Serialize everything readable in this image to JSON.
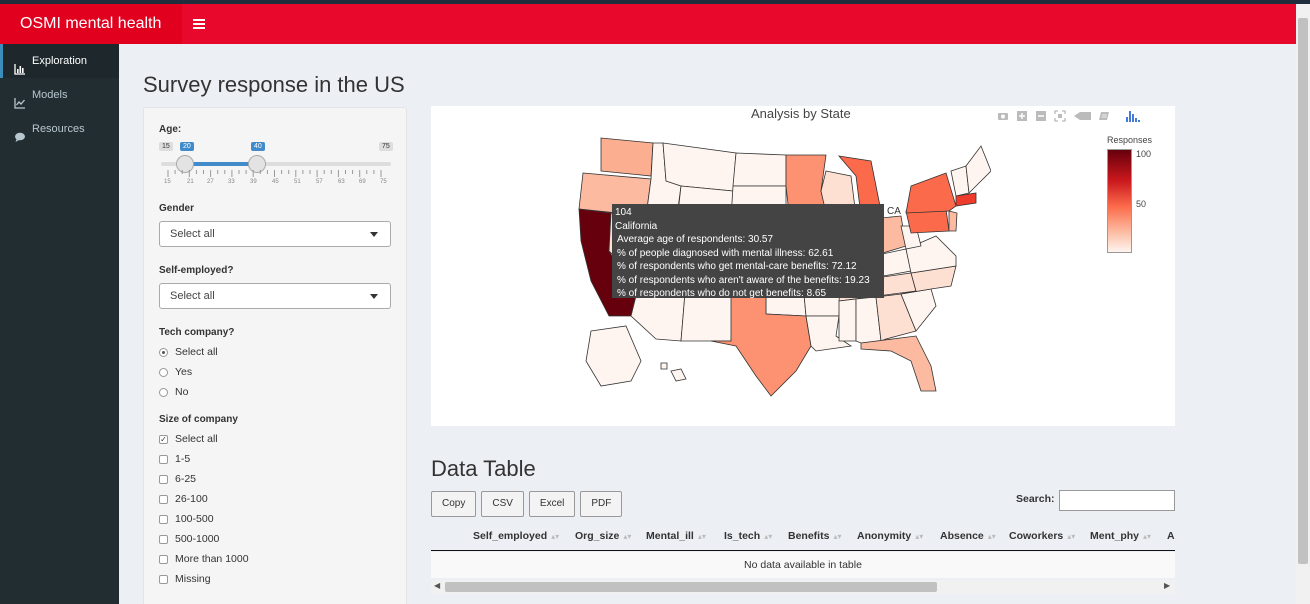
{
  "app": {
    "title": "OSMI mental health",
    "menu_icon": "hamburger-icon"
  },
  "sidebar": {
    "items": [
      {
        "label": "Exploration",
        "icon": "bar-chart-icon",
        "active": true
      },
      {
        "label": "Models",
        "icon": "line-chart-icon",
        "active": false
      },
      {
        "label": "Resources",
        "icon": "comment-icon",
        "active": false
      }
    ]
  },
  "page": {
    "title": "Survey response in the US"
  },
  "filters": {
    "age": {
      "label": "Age:",
      "min": "15",
      "max": "75",
      "from": "20",
      "to": "40",
      "ticks": [
        "15",
        "21",
        "27",
        "33",
        "39",
        "45",
        "51",
        "57",
        "63",
        "69",
        "75"
      ]
    },
    "gender": {
      "label": "Gender",
      "selected": "Select all"
    },
    "self_employed": {
      "label": "Self-employed?",
      "selected": "Select all"
    },
    "tech_company": {
      "label": "Tech company?",
      "options": [
        "Select all",
        "Yes",
        "No"
      ],
      "selected": "Select all"
    },
    "company_size": {
      "label": "Size of company",
      "options": [
        "Select all",
        "1-5",
        "6-25",
        "26-100",
        "100-500",
        "500-1000",
        "More than 1000",
        "Missing"
      ],
      "checked": [
        "Select all"
      ]
    }
  },
  "map": {
    "title": "Analysis by State",
    "legend_title": "Responses",
    "legend_ticks": [
      "100",
      "50"
    ],
    "state_label_ca": "CA",
    "colors": {
      "high": "#67000d",
      "mid": "#fb6a4a",
      "low": "#fff5f0"
    },
    "tooltip": {
      "line1": "104",
      "line2": "California",
      "line3": "Average age of respondents: 30.57",
      "line4": "% of people diagnosed with mental illness: 62.61",
      "line5": "% of respondents who get mental-care benefits: 72.12",
      "line6": "% of respondents who aren't aware of the benefits: 19.23",
      "line7": "% of respondents who do not get benefits: 8.65"
    }
  },
  "table": {
    "title": "Data Table",
    "buttons": [
      "Copy",
      "CSV",
      "Excel",
      "PDF"
    ],
    "search_label": "Search:",
    "columns": [
      "Self_employed",
      "Org_size",
      "Mental_ill",
      "Is_tech",
      "Benefits",
      "Anonymity",
      "Absence",
      "Coworkers",
      "Ment_phy",
      "A"
    ],
    "empty_message": "No data available in table"
  }
}
